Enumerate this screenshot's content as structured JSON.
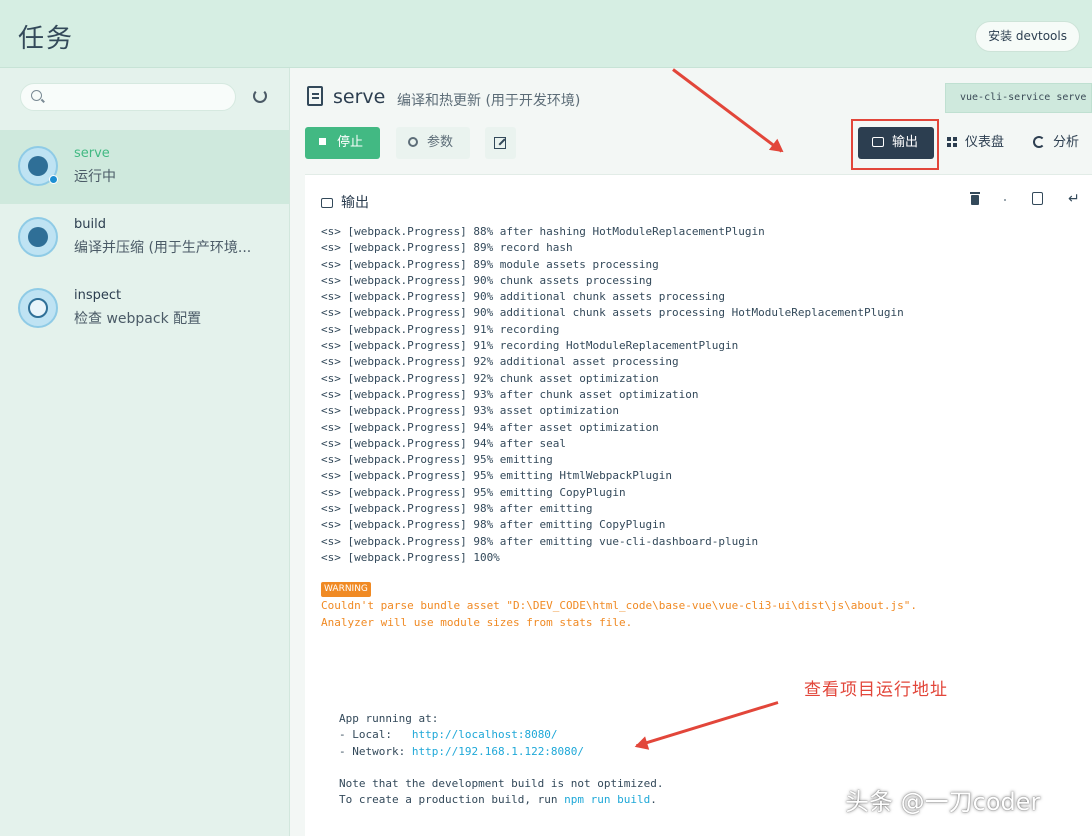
{
  "header": {
    "title": "任务",
    "install_devtools": "安装 devtools"
  },
  "sidebar": {
    "search_placeholder": "",
    "items": [
      {
        "name": "serve",
        "desc": "运行中",
        "active": true
      },
      {
        "name": "build",
        "desc": "编译并压缩 (用于生产环境..."
      },
      {
        "name": "inspect",
        "desc": "检查 webpack 配置"
      }
    ]
  },
  "task": {
    "title": "serve",
    "subtitle": "编译和热更新 (用于开发环境)",
    "command": "vue-cli-service serve",
    "buttons": {
      "stop": "停止",
      "params": "参数"
    },
    "tabs": {
      "output": "输出",
      "dashboard": "仪表盘",
      "analyze": "分析"
    }
  },
  "output": {
    "title": "输出",
    "log_lines": [
      "<s> [webpack.Progress] 88% after hashing HotModuleReplacementPlugin",
      "<s> [webpack.Progress] 89% record hash",
      "<s> [webpack.Progress] 89% module assets processing",
      "<s> [webpack.Progress] 90% chunk assets processing",
      "<s> [webpack.Progress] 90% additional chunk assets processing",
      "<s> [webpack.Progress] 90% additional chunk assets processing HotModuleReplacementPlugin",
      "<s> [webpack.Progress] 91% recording",
      "<s> [webpack.Progress] 91% recording HotModuleReplacementPlugin",
      "<s> [webpack.Progress] 92% additional asset processing",
      "<s> [webpack.Progress] 92% chunk asset optimization",
      "<s> [webpack.Progress] 93% after chunk asset optimization",
      "<s> [webpack.Progress] 93% asset optimization",
      "<s> [webpack.Progress] 94% after asset optimization",
      "<s> [webpack.Progress] 94% after seal",
      "<s> [webpack.Progress] 95% emitting",
      "<s> [webpack.Progress] 95% emitting HtmlWebpackPlugin",
      "<s> [webpack.Progress] 95% emitting CopyPlugin",
      "<s> [webpack.Progress] 98% after emitting",
      "<s> [webpack.Progress] 98% after emitting CopyPlugin",
      "<s> [webpack.Progress] 98% after emitting vue-cli-dashboard-plugin",
      "<s> [webpack.Progress] 100%"
    ],
    "warning_badge": "WARNING",
    "warning_text": "Couldn't parse bundle asset \"D:\\DEV_CODE\\html_code\\base-vue\\vue-cli3-ui\\dist\\js\\about.js\".\nAnalyzer will use module sizes from stats file.",
    "app_running": "App running at:",
    "local_label": "- Local:   ",
    "local_url": "http://localhost:8080/",
    "network_label": "- Network: ",
    "network_url": "http://192.168.1.122:8080/",
    "note_line1": "Note that the development build is not optimized.",
    "note_line2_prefix": "To create a production build, run ",
    "note_line2_cmd": "npm run build",
    "note_line2_suffix": "."
  },
  "annotation": "查看项目运行地址",
  "watermark": "头条 @一刀coder",
  "colors": {
    "accent": "#42b983",
    "dark": "#2c3e50",
    "highlight": "#e2463a",
    "warning": "#f08a24",
    "link": "#1fa8d8"
  }
}
